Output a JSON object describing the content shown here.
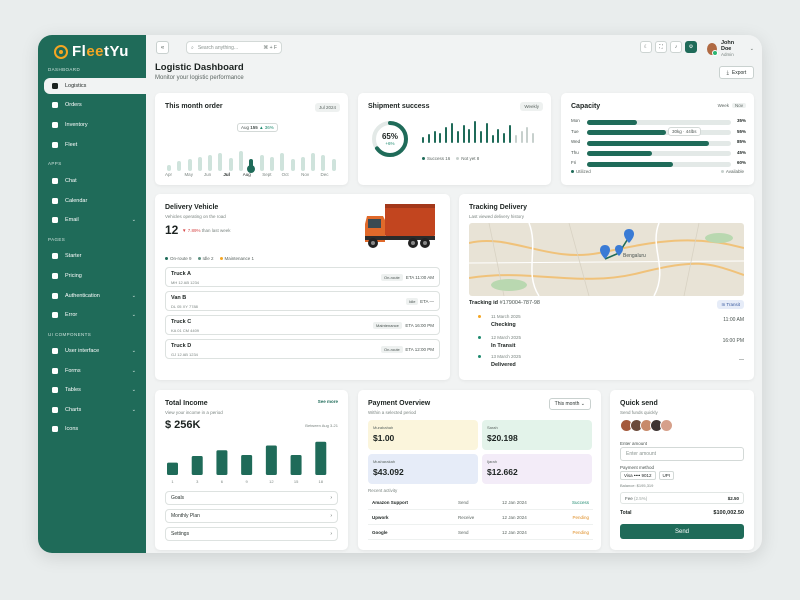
{
  "brand": {
    "name_start": "Fl",
    "name_hl": "ee",
    "name_end": "tYu"
  },
  "sidebar": {
    "sections": {
      "dashboard": "DASHBOARD",
      "apps": "APPS",
      "pages": "PAGES",
      "ui": "UI COMPONENTS"
    },
    "items": [
      {
        "label": "Logistics",
        "icon": "bookmark-icon",
        "active": true
      },
      {
        "label": "Orders",
        "icon": "orders-icon"
      },
      {
        "label": "Inventory",
        "icon": "inventory-icon"
      },
      {
        "label": "Fleet",
        "icon": "truck-icon"
      },
      {
        "label": "Chat",
        "icon": "chat-icon"
      },
      {
        "label": "Calendar",
        "icon": "calendar-icon"
      },
      {
        "label": "Email",
        "icon": "mail-icon",
        "chevron": true
      },
      {
        "label": "Starter",
        "icon": "rocket-icon"
      },
      {
        "label": "Pricing",
        "icon": "tag-icon"
      },
      {
        "label": "Authentication",
        "icon": "shield-icon",
        "chevron": true
      },
      {
        "label": "Error",
        "icon": "alert-icon",
        "chevron": true
      },
      {
        "label": "User interface",
        "icon": "grid-icon",
        "chevron": true
      },
      {
        "label": "Forms",
        "icon": "form-icon",
        "chevron": true
      },
      {
        "label": "Tables",
        "icon": "table-icon",
        "chevron": true
      },
      {
        "label": "Charts",
        "icon": "chart-icon",
        "chevron": true
      },
      {
        "label": "Icons",
        "icon": "palette-icon"
      }
    ]
  },
  "topbar": {
    "search_placeholder": "Search anything...",
    "shortcut": "⌘ + F",
    "user_name": "John Doe",
    "user_role": "Admin"
  },
  "header": {
    "title": "Logistic Dashboard",
    "subtitle": "Monitor your logistic performance",
    "export": "Export"
  },
  "month_order": {
    "title": "This month order",
    "period": "Jul 2024",
    "tooltip_label": "Aug",
    "tooltip_value": "155",
    "tooltip_change": "▲ 36%",
    "chart_data": {
      "type": "bar",
      "categories": [
        "Apr",
        "May",
        "Jun",
        "Jul",
        "Aug",
        "Sept",
        "Oct",
        "Nov",
        "Dec"
      ],
      "highlight": "Aug"
    }
  },
  "shipment": {
    "title": "Shipment success",
    "period": "Weekly",
    "percent": "65%",
    "change": "+6%",
    "success_label": "Success 16",
    "not_label": "Not yet 8"
  },
  "capacity": {
    "title": "Capacity",
    "tabs": [
      "Week",
      "Nov"
    ],
    "tooltip": "30kg · 44lbs",
    "legend_utilized": "Utilized",
    "legend_available": "Available",
    "chart_data": {
      "type": "bar",
      "categories": [
        "Mon",
        "Tue",
        "Wed",
        "Thu",
        "Fri"
      ],
      "values": [
        35,
        55,
        85,
        45,
        60
      ],
      "labels": [
        "35%",
        "55%",
        "85%",
        "45%",
        "60%"
      ]
    }
  },
  "delivery": {
    "title": "Delivery Vehicle",
    "subtitle": "Vehicles operating on the road",
    "count": "12",
    "change": "▼ 7.89%",
    "change_suffix": "than last week",
    "legend": [
      "On-route 9",
      "Idle 2",
      "Maintenance 1"
    ],
    "vehicles": [
      {
        "name": "Truck A",
        "plate": "MH 12 AB 1234",
        "status": "On-route",
        "eta": "ETA 11:00 AM"
      },
      {
        "name": "Van B",
        "plate": "DL 05 XY 7788",
        "status": "Idle",
        "eta": "ETA —"
      },
      {
        "name": "Truck C",
        "plate": "KA 01 CM 4409",
        "status": "Maintenance",
        "eta": "ETA 16:00 PM"
      },
      {
        "name": "Truck D",
        "plate": "GJ 12 AB 1234",
        "status": "On-route",
        "eta": "ETA 12:00 PM"
      }
    ]
  },
  "tracking": {
    "title": "Tracking Delivery",
    "subtitle": "Last viewed delivery history",
    "map_city": "Bengaluru",
    "id_label": "Tracking id",
    "id_value": "#179004-787-98",
    "status_badge": "In Transit",
    "steps": [
      {
        "date": "11 March 2025",
        "status": "Checking",
        "time": "11:00 AM",
        "color": "#f5a623"
      },
      {
        "date": "12 March 2025",
        "status": "In Transit",
        "time": "16:00 PM",
        "color": "#1f8a6f"
      },
      {
        "date": "13 March 2025",
        "status": "Delivered",
        "time": "—",
        "color": "#1f8a6f"
      }
    ]
  },
  "income": {
    "title": "Total Income",
    "subtitle": "View your income in a period",
    "see_more": "See more",
    "amount": "$ 256K",
    "period": "Between Aug 3-21",
    "chart_data": {
      "type": "bar",
      "categories": [
        "1",
        "3",
        "6",
        "9",
        "12",
        "15",
        "18"
      ],
      "values": [
        13,
        20,
        26,
        21,
        31,
        21,
        35
      ],
      "ylim": [
        0,
        40
      ]
    },
    "links": [
      "Goals",
      "Monthly Plan",
      "Settings"
    ]
  },
  "payment": {
    "title": "Payment Overview",
    "subtitle": "Within a selected period",
    "period": "This month",
    "boxes": [
      {
        "label": "Murabahah",
        "value": "$1.00",
        "bg": "#fbf5dc"
      },
      {
        "label": "Sarah",
        "value": "$20.198",
        "bg": "#e3f3ea"
      },
      {
        "label": "Musharakah",
        "value": "$43.092",
        "bg": "#e6ecf8"
      },
      {
        "label": "Ijarah",
        "value": "$12.662",
        "bg": "#f3ecf8"
      }
    ],
    "recent_label": "Recent activity",
    "activity": [
      {
        "name": "Amazon Support",
        "type": "Send",
        "date": "12 Jan 2024",
        "status": "Success",
        "color": "#1f8a6f"
      },
      {
        "name": "Upwork",
        "type": "Receive",
        "date": "12 Jan 2024",
        "status": "Pending",
        "color": "#e0902a"
      },
      {
        "name": "Google",
        "type": "Send",
        "date": "12 Jan 2024",
        "status": "Pending",
        "color": "#e0902a"
      }
    ]
  },
  "quick_send": {
    "title": "Quick send",
    "subtitle": "Send funds quickly",
    "amount_label": "Enter amount",
    "amount_placeholder": "Enter amount",
    "method_label": "Payment method",
    "method_visa": "Visa •••• 9012",
    "method_upi": "UPI",
    "balance": "Balance: $195,319",
    "fee_label": "Fee",
    "fee_pct": "(2.5%)",
    "fee_value": "$2.50",
    "total_label": "Total",
    "total_value": "$100,002.50",
    "send": "Send"
  }
}
